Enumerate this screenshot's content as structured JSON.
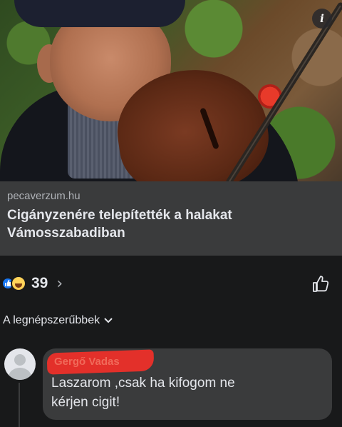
{
  "post": {
    "image": {
      "description_icon": "info-icon",
      "info_label": "i"
    },
    "link": {
      "domain": "pecaverzum.hu",
      "title_line1": "Cigányzenére telepítették a halakat",
      "title_line2": "Vámosszabadiban"
    }
  },
  "reactions": {
    "icons": [
      "like-reaction-icon",
      "haha-reaction-icon"
    ],
    "count": "39",
    "chevron": "›",
    "like_button_icon": "thumbs-up-icon"
  },
  "comments": {
    "sort_label": "A legnépszerűbbek",
    "sort_chevron": "⌄",
    "items": [
      {
        "author": "Gergő Vadas",
        "text_line1": "Laszarom ,csak ha kifogom ne",
        "text_line2": "kérjen cigit!"
      }
    ]
  },
  "colors": {
    "background": "#18191a",
    "card": "#3a3b3c",
    "text": "#e4e6eb",
    "secondary_text": "#b0b3b8",
    "like_blue": "#1877f2",
    "scribble_red": "#e3302a"
  }
}
